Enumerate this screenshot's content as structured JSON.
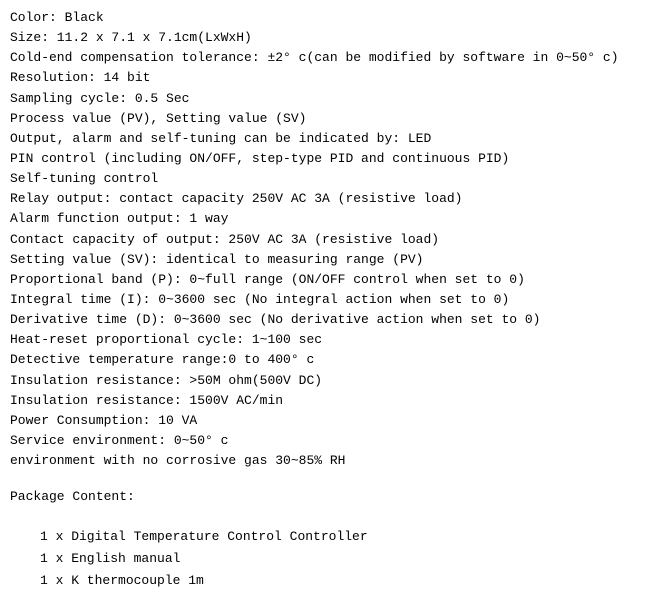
{
  "specs": {
    "lines": [
      "Color: Black",
      "Size: 11.2 x 7.1 x 7.1cm(LxWxH)",
      "Cold-end compensation tolerance: ±2° c(can be modified by software in 0~50° c)",
      "Resolution: 14 bit",
      "Sampling cycle: 0.5 Sec",
      "Process value (PV), Setting value (SV)",
      "Output, alarm and self-tuning can be indicated by: LED",
      "PIN control (including ON/OFF, step-type PID and continuous PID)",
      "Self-tuning control",
      "Relay output: contact capacity 250V AC 3A (resistive load)",
      "Alarm function output: 1 way",
      "Contact capacity of output: 250V AC 3A (resistive load)",
      "Setting value (SV): identical to measuring range (PV)",
      "Proportional band (P): 0~full range (ON/OFF control when set to 0)",
      "Integral time (I): 0~3600 sec (No integral action when set to 0)",
      "Derivative time (D): 0~3600 sec (No derivative action when set to 0)",
      "Heat-reset proportional cycle: 1~100 sec",
      "Detective temperature range:0 to 400° c",
      "Insulation resistance: >50M ohm(500V DC)",
      "Insulation resistance: 1500V AC/min",
      "Power Consumption: 10 VA",
      "Service environment: 0~50° c",
      "environment with no corrosive gas 30~85% RH"
    ]
  },
  "package": {
    "title": "Package Content:",
    "items": [
      "1 x Digital Temperature Control Controller",
      "1 x English manual",
      "1 x K thermocouple 1m"
    ]
  }
}
